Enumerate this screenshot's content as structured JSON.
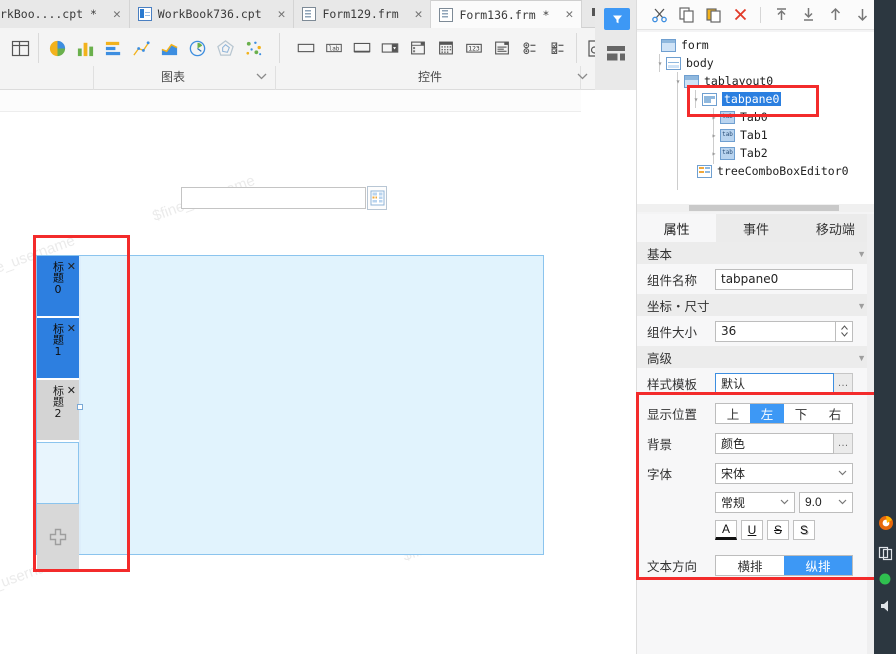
{
  "window": {
    "doc_tabs": [
      {
        "label": "rkBoo....cpt *",
        "icon": "cpt-file-icon",
        "active": false,
        "truncated": true
      },
      {
        "label": "WorkBook736.cpt",
        "icon": "cpt-file-icon",
        "active": false
      },
      {
        "label": "Form129.frm",
        "icon": "frm-file-icon",
        "active": false
      },
      {
        "label": "Form136.frm *",
        "icon": "frm-file-icon",
        "active": true
      }
    ],
    "tab_close_glyph": "✕",
    "tab_overflow_icon": "tab-overflow-icon"
  },
  "ribbon": {
    "groups": [
      {
        "name": "chart",
        "label": "图表",
        "chevron": "∨",
        "items": [
          {
            "icon": "pie-chart-icon"
          },
          {
            "icon": "bar-chart-icon"
          },
          {
            "icon": "horizontal-bar-chart-icon"
          },
          {
            "icon": "scatter-line-chart-icon"
          },
          {
            "icon": "area-chart-icon"
          },
          {
            "icon": "gauge-chart-icon"
          },
          {
            "icon": "radar-chart-icon"
          },
          {
            "icon": "bubble-chart-icon"
          }
        ]
      },
      {
        "name": "controls",
        "label": "控件",
        "chevron": "∨",
        "items": [
          {
            "icon": "textfield-icon"
          },
          {
            "icon": "label-icon"
          },
          {
            "icon": "textarea-icon"
          },
          {
            "icon": "combobox-icon"
          },
          {
            "icon": "combobox-checkbox-icon"
          },
          {
            "icon": "date-picker-icon"
          },
          {
            "icon": "number-field-icon"
          },
          {
            "icon": "tree-editor-icon"
          },
          {
            "icon": "radio-group-icon"
          },
          {
            "icon": "checkbox-group-icon"
          }
        ]
      }
    ],
    "grid_icon": "grid-layout-icon",
    "preview_icon": "preview-report-icon",
    "blue_action_icon": "filter-funnel-icon",
    "panel_layout_icon": "panel-layout-icon"
  },
  "canvas": {
    "search_input_value": "",
    "search_input_placeholder": "",
    "search_button_icon": "tree-combobox-icon",
    "watermark_text": "$fine_username",
    "tabpane": {
      "tabs": [
        {
          "label": "标题0",
          "state": "selected",
          "close": "✕"
        },
        {
          "label": "标题1",
          "state": "selected",
          "close": "✕"
        },
        {
          "label": "标题2",
          "state": "unselected",
          "close": "✕"
        }
      ],
      "add_tab_icon": "add-tab-plus-icon"
    }
  },
  "right_panel": {
    "toolbar": [
      {
        "icon": "cut-icon"
      },
      {
        "icon": "copy-icon"
      },
      {
        "icon": "paste-icon"
      },
      {
        "icon": "delete-icon"
      },
      {
        "icon": "move-to-top-icon"
      },
      {
        "icon": "move-to-bottom-icon"
      },
      {
        "icon": "move-up-icon"
      },
      {
        "icon": "move-down-icon"
      }
    ],
    "tree": [
      {
        "label": "form",
        "depth": 0,
        "icon": "form-node-icon",
        "arrow": "",
        "selected": false
      },
      {
        "label": "body",
        "depth": 1,
        "icon": "body-node-icon",
        "arrow": "▾",
        "selected": false
      },
      {
        "label": "tablayout0",
        "depth": 2,
        "icon": "tablayout-node-icon",
        "arrow": "▾",
        "selected": false
      },
      {
        "label": "tabpane0",
        "depth": 3,
        "icon": "tabpane-node-icon",
        "arrow": "▾",
        "selected": true
      },
      {
        "label": "Tab0",
        "depth": 4,
        "icon": "tab-node-icon",
        "arrow": "▸",
        "selected": false
      },
      {
        "label": "Tab1",
        "depth": 4,
        "icon": "tab-node-icon",
        "arrow": "▸",
        "selected": false
      },
      {
        "label": "Tab2",
        "depth": 4,
        "icon": "tab-node-icon",
        "arrow": "▸",
        "selected": false
      },
      {
        "label": "treeComboBoxEditor0",
        "depth": 2,
        "icon": "treecombobox-node-icon",
        "arrow": "",
        "selected": false
      }
    ],
    "prop_tabs": [
      {
        "label": "属性",
        "active": true
      },
      {
        "label": "事件",
        "active": false
      },
      {
        "label": "移动端",
        "active": false
      }
    ],
    "sections": {
      "basic": {
        "title": "基本",
        "chevron": "▼",
        "component_name_label": "组件名称",
        "component_name_value": "tabpane0"
      },
      "coords": {
        "title": "坐标・尺寸",
        "chevron": "▼",
        "size_label": "组件大小",
        "size_value": "36"
      },
      "advanced": {
        "title": "高级",
        "chevron": "▼",
        "style_template_label": "样式模板",
        "style_template_value": "默认",
        "style_template_more": "…",
        "display_position_label": "显示位置",
        "display_position_options": [
          "上",
          "左",
          "下",
          "右"
        ],
        "display_position_selected": "左",
        "background_label": "背景",
        "background_value": "颜色",
        "background_more": "…",
        "font_label": "字体",
        "font_family_value": "宋体",
        "font_style_value": "常规",
        "font_size_value": "9.0",
        "font_buttons": [
          {
            "glyph": "A",
            "name": "font-color-button"
          },
          {
            "glyph": "U",
            "name": "underline-button"
          },
          {
            "glyph": "S",
            "name": "strikethrough-button"
          },
          {
            "glyph": "S",
            "name": "shadow-button"
          }
        ],
        "text_direction_label": "文本方向",
        "text_direction_options": [
          "横排",
          "纵排"
        ],
        "text_direction_selected": "纵排"
      }
    }
  },
  "dock": {
    "icons": [
      {
        "name": "firefox-icon"
      },
      {
        "name": "window-copy-icon"
      },
      {
        "name": "status-dot-icon"
      },
      {
        "name": "volume-icon"
      }
    ]
  },
  "colors": {
    "accent_blue": "#3d98f5",
    "tab_selected_blue": "#2d7fe0",
    "annotation_red": "#f32b2b",
    "canvas_fill": "#e1f3fd",
    "tree_selection": "#2b7fe0"
  }
}
